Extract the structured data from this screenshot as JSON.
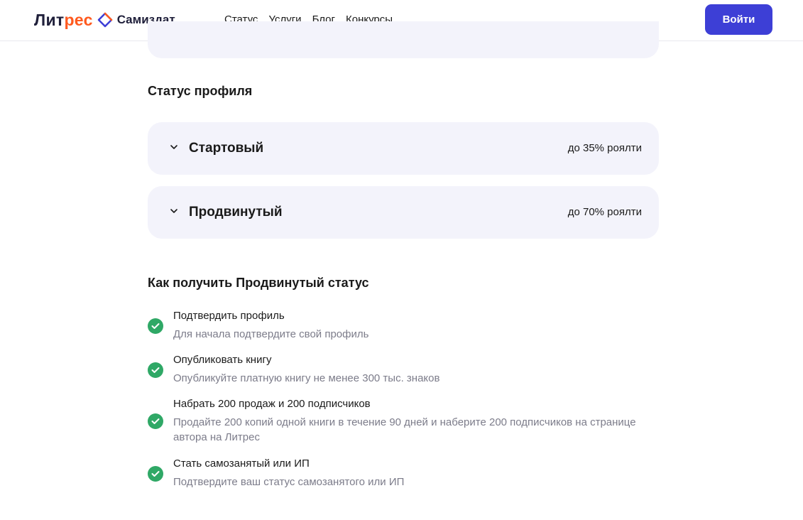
{
  "header": {
    "logo_part1": "Лит",
    "logo_part2": "рес",
    "logo_sub": "Самиздат",
    "nav": [
      "Статус",
      "Услуги",
      "Блог",
      "Конкурсы"
    ],
    "login_label": "Войти"
  },
  "profile_status": {
    "title": "Статус профиля",
    "levels": [
      {
        "name": "Стартовый",
        "royalty": "до 35% роялти"
      },
      {
        "name": "Продвинутый",
        "royalty": "до 70% роялти"
      }
    ]
  },
  "advanced": {
    "title": "Как получить Продвинутый статус",
    "steps": [
      {
        "title": "Подтвердить профиль",
        "desc": "Для начала подтвердите свой профиль"
      },
      {
        "title": "Опубликовать книгу",
        "desc": "Опубликуйте платную книгу не менее 300 тыс. знаков"
      },
      {
        "title": "Набрать 200 продаж и 200 подписчиков",
        "desc": "Продайте 200 копий одной книги в течение 90 дней и наберите 200 подписчиков на странице автора на Литрес"
      },
      {
        "title": "Стать самозанятый или ИП",
        "desc": "Подтвердите ваш статус самозанятого или ИП"
      }
    ]
  },
  "colors": {
    "accent": "#3d3fd6",
    "brand_orange": "#ff5a1f",
    "card_bg": "#f3f3fb",
    "check_green": "#2fa866"
  },
  "icons": [
    "logo-diamond-icon",
    "chevron-down-icon",
    "check-circle-icon"
  ]
}
